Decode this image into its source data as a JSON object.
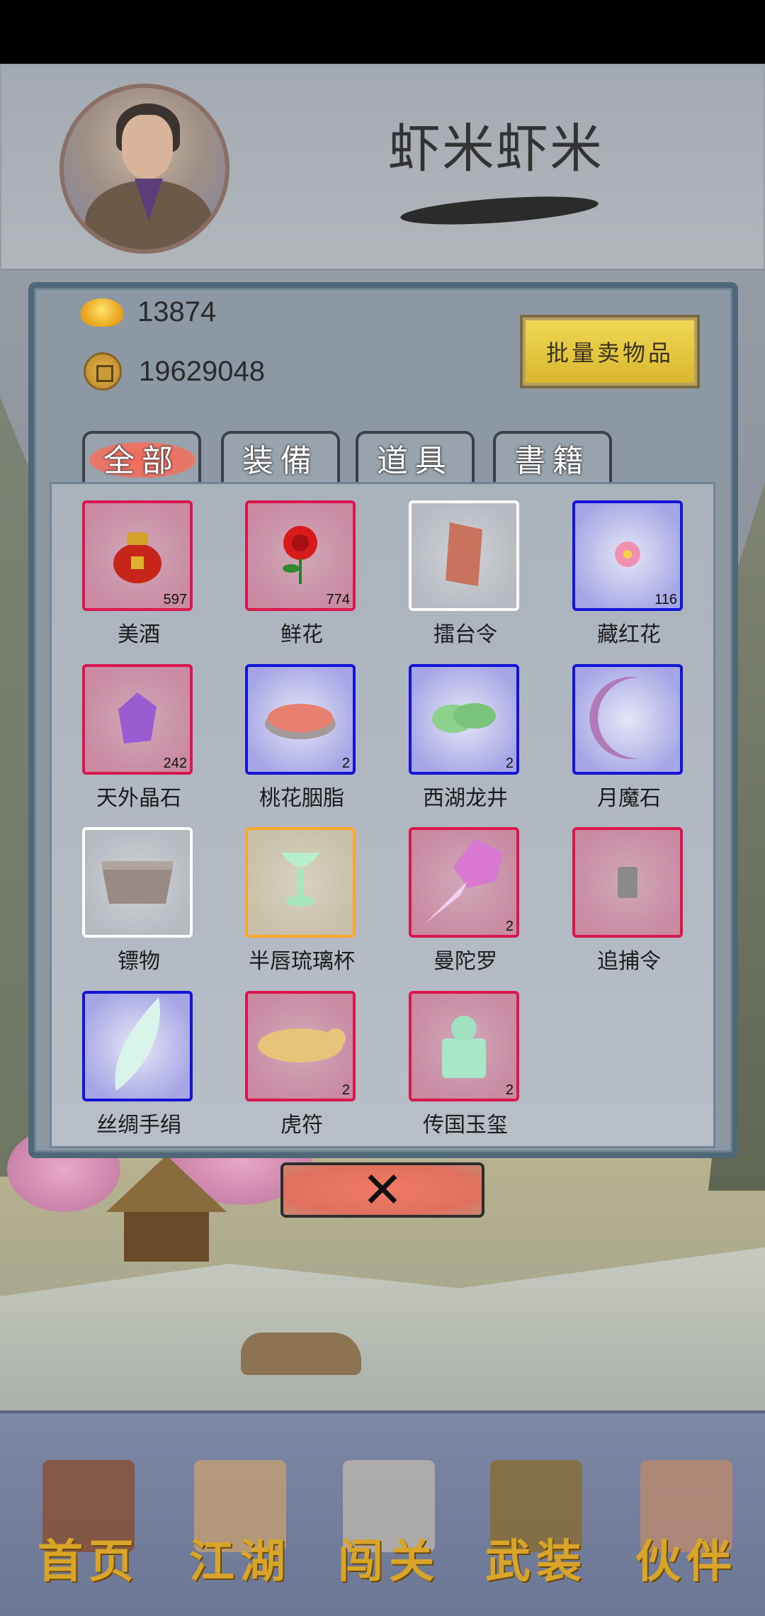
{
  "player": {
    "name": "虾米虾米"
  },
  "currency": {
    "gold_ingots": "13874",
    "copper_coins": "19629048"
  },
  "sell_button": {
    "label": "批量卖物品"
  },
  "tabs": [
    {
      "label": "全部",
      "active": true
    },
    {
      "label": "装備",
      "active": false
    },
    {
      "label": "道具",
      "active": false
    },
    {
      "label": "書籍",
      "active": false
    }
  ],
  "inventory": [
    {
      "name": "美酒",
      "count": "597",
      "rarity": "red",
      "icon": "wine-jar-icon"
    },
    {
      "name": "鲜花",
      "count": "774",
      "rarity": "red",
      "icon": "rose-icon"
    },
    {
      "name": "擂台令",
      "count": "",
      "rarity": "white",
      "icon": "arena-token-icon"
    },
    {
      "name": "藏红花",
      "count": "116",
      "rarity": "blue",
      "icon": "saffron-flower-icon"
    },
    {
      "name": "天外晶石",
      "count": "242",
      "rarity": "red",
      "icon": "crystal-icon"
    },
    {
      "name": "桃花胭脂",
      "count": "2",
      "rarity": "blue",
      "icon": "rouge-icon"
    },
    {
      "name": "西湖龙井",
      "count": "2",
      "rarity": "blue",
      "icon": "tea-leaves-icon"
    },
    {
      "name": "月魔石",
      "count": "",
      "rarity": "blue",
      "icon": "crescent-moon-icon"
    },
    {
      "name": "镖物",
      "count": "",
      "rarity": "white",
      "icon": "cargo-box-icon"
    },
    {
      "name": "半唇琉璃杯",
      "count": "",
      "rarity": "orange",
      "icon": "glass-cup-icon"
    },
    {
      "name": "曼陀罗",
      "count": "2",
      "rarity": "red",
      "icon": "datura-flower-icon"
    },
    {
      "name": "追捕令",
      "count": "",
      "rarity": "red",
      "icon": "warrant-token-icon"
    },
    {
      "name": "丝绸手绢",
      "count": "",
      "rarity": "blue",
      "icon": "silk-handkerchief-icon"
    },
    {
      "name": "虎符",
      "count": "2",
      "rarity": "red",
      "icon": "tiger-tally-icon"
    },
    {
      "name": "传国玉玺",
      "count": "2",
      "rarity": "red",
      "icon": "jade-seal-icon"
    }
  ],
  "close_button": {
    "icon": "close-x-icon"
  },
  "nav": [
    {
      "label": "首页",
      "icon": "house-icon"
    },
    {
      "label": "江湖",
      "icon": "scroll-icon"
    },
    {
      "label": "闯关",
      "icon": "crossed-swords-icon"
    },
    {
      "label": "武装",
      "icon": "armor-icon"
    },
    {
      "label": "伙伴",
      "icon": "partners-icon"
    }
  ],
  "colors": {
    "rarity_red": "#d9174f",
    "rarity_blue": "#1414d6",
    "rarity_white": "#ffffff",
    "rarity_orange": "#ffa62a",
    "nav_label": "#d8a528",
    "sell_button": "#f1d956",
    "close_button": "#f07b66"
  }
}
